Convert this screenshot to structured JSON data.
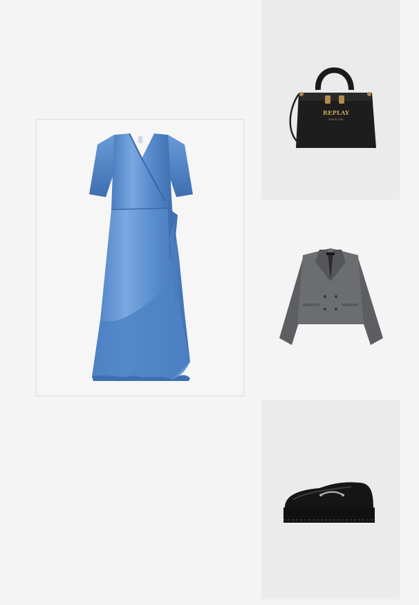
{
  "outfit": {
    "items": [
      {
        "id": "dress",
        "product": "satin wrap midi dress",
        "color": "#5b8fcf"
      },
      {
        "id": "bag",
        "product": "black top-handle tote bag",
        "brand_logo": "REPLAY",
        "brand_sub": "SINCE 1981",
        "color": "#1a1a1a"
      },
      {
        "id": "blazer",
        "product": "grey cropped double-breasted blazer",
        "color": "#6b6d70"
      },
      {
        "id": "shoes",
        "product": "black chunky horsebit loafer",
        "color": "#151515"
      }
    ]
  },
  "colors": {
    "page_bg": "#f4f4f4",
    "tile_bg": "#ebebeb",
    "border": "#dcdcdc"
  }
}
